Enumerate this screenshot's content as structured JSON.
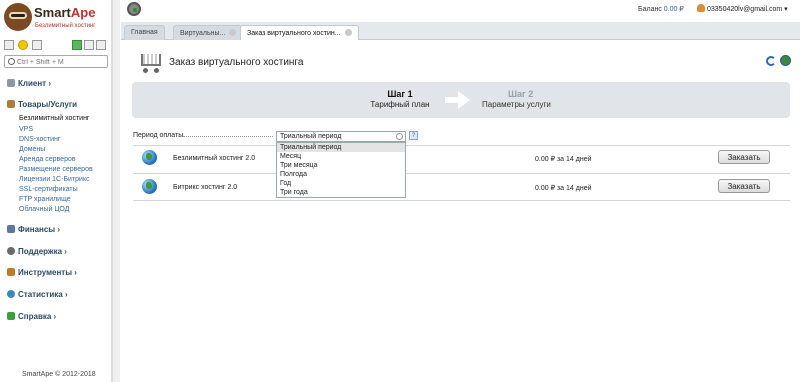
{
  "brand": {
    "name_main": "Smart",
    "name_accent": "Ape",
    "tagline": "Безлимитный хостинг"
  },
  "sidebar": {
    "search_placeholder": "Ctrl + Shift + M",
    "sections": {
      "client": "Клиент",
      "products": "Товары/Услуги",
      "finance": "Финансы",
      "support": "Поддержка",
      "tools": "Инструменты",
      "stats": "Статистика",
      "help": "Справка"
    },
    "product_items": [
      "Безлимитный хостинг",
      "VPS",
      "DNS-хостинг",
      "Домены",
      "Аренда серверов",
      "Размещение серверов",
      "Лицензии 1С-Битрикс",
      "SSL-сертификаты",
      "FTP хранилище",
      "Облачный ЦОД"
    ],
    "copyright": "SmartApe © 2012-2018"
  },
  "topbar": {
    "balance_label": "Баланс",
    "balance_value": "0.00 ₽",
    "user_email": "03350420lv@gmail.com"
  },
  "tabs": [
    "Главная",
    "Виртуальны...",
    "Заказ виртуального хостин..."
  ],
  "page": {
    "title": "Заказ виртуального хостинга"
  },
  "wizard": {
    "step1_title": "Шаг 1",
    "step1_sub": "Тарифный план",
    "step2_title": "Шаг 2",
    "step2_sub": "Параметры услуги"
  },
  "period": {
    "label": "Период оплаты",
    "selected": "Триальный период",
    "options": [
      "Триальный период",
      "Месяц",
      "Три месяца",
      "Полгода",
      "Год",
      "Три года"
    ]
  },
  "products": [
    {
      "name": "Безлимитный хостинг 2.0",
      "price": "0.00 ₽ за 14 дней",
      "button": "Заказать"
    },
    {
      "name": "Битрикс хостинг 2.0",
      "price": "0.00 ₽ за 14 дней",
      "button": "Заказать"
    }
  ],
  "colors": {
    "link": "#3a6aa0",
    "section": "#2b4a6a",
    "wizard_bg": "#e1e4e8"
  }
}
